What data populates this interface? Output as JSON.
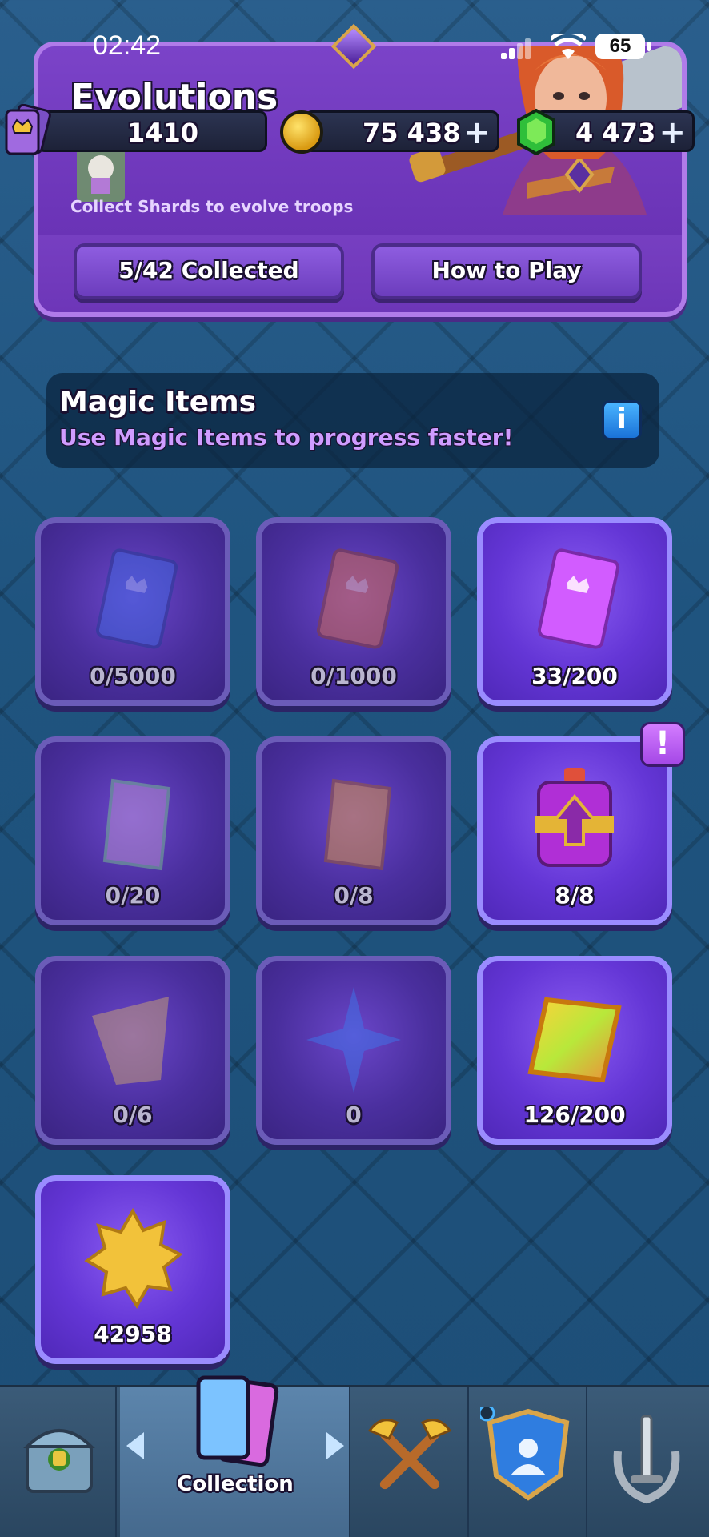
{
  "status_bar": {
    "time": "02:42",
    "battery": "65"
  },
  "header": {
    "title": "Evolutions",
    "subtitle": "Collect Shards to evolve troops",
    "collected_button": "5/42 Collected",
    "how_to_play_button": "How to Play"
  },
  "currencies": {
    "cards": "1410",
    "gold": "75 438",
    "gems": "4 473",
    "plus": "+"
  },
  "magic_items": {
    "title": "Magic Items",
    "subtitle": "Use Magic Items to progress faster!",
    "info": "i"
  },
  "items": [
    {
      "name": "common-wild-card",
      "count": "0/5000"
    },
    {
      "name": "rare-wild-card",
      "count": "0/1000"
    },
    {
      "name": "epic-wild-card",
      "count": "33/200"
    },
    {
      "name": "legendary-wild-card",
      "count": "0/20"
    },
    {
      "name": "champion-wild-card",
      "count": "0/8"
    },
    {
      "name": "elixir-potion",
      "count": "8/8"
    },
    {
      "name": "evolution-shard",
      "count": "0/6"
    },
    {
      "name": "star-points",
      "count": "0"
    },
    {
      "name": "rainbow-shard",
      "count": "126/200"
    },
    {
      "name": "gold-badge",
      "count": "42958"
    }
  ],
  "alert_badge": "!",
  "nav": {
    "collection_label": "Collection"
  },
  "colors": {
    "panel": "#7b43c8",
    "tile_border": "#6b5cb8",
    "tile_active": "#9a8cff",
    "accent_text": "#cf9cff"
  }
}
